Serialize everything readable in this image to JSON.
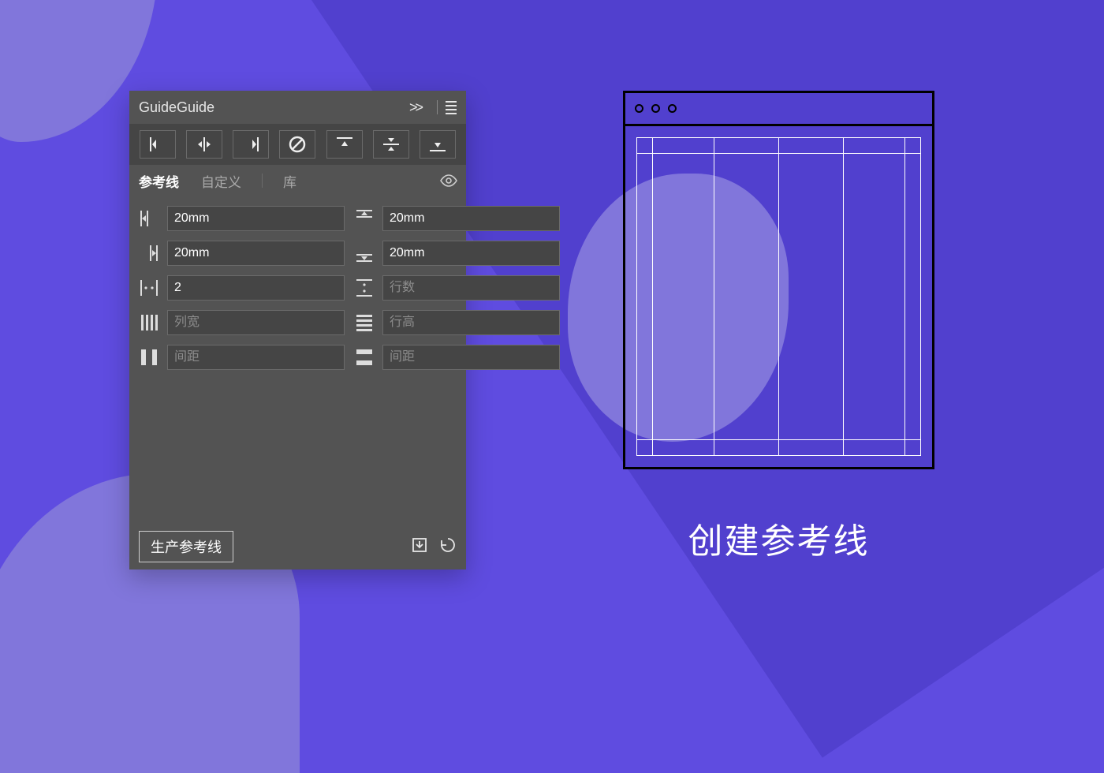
{
  "panel": {
    "title": "GuideGuide",
    "header_collapse": ">>",
    "tabs": {
      "guides": "参考线",
      "custom": "自定义",
      "library": "库"
    },
    "fields": {
      "left_margin": {
        "value": "20mm"
      },
      "right_margin": {
        "value": "20mm"
      },
      "columns": {
        "value": "2"
      },
      "col_width": {
        "placeholder": "列宽"
      },
      "col_gutter": {
        "placeholder": "间距"
      },
      "top_margin": {
        "value": "20mm"
      },
      "bottom_margin": {
        "value": "20mm"
      },
      "rows": {
        "placeholder": "行数"
      },
      "row_height": {
        "placeholder": "行高"
      },
      "row_gutter": {
        "placeholder": "间距"
      }
    },
    "footer": {
      "generate": "生产参考线"
    }
  },
  "caption": "创建参考线",
  "colors": {
    "bg": "#5f4ce0",
    "bg_shadow": "#5140ce",
    "blob": "#8176db",
    "panel": "#535353",
    "panel_dark": "#454545",
    "border": "#6a6a6a",
    "text_light": "#e6e6e6"
  }
}
